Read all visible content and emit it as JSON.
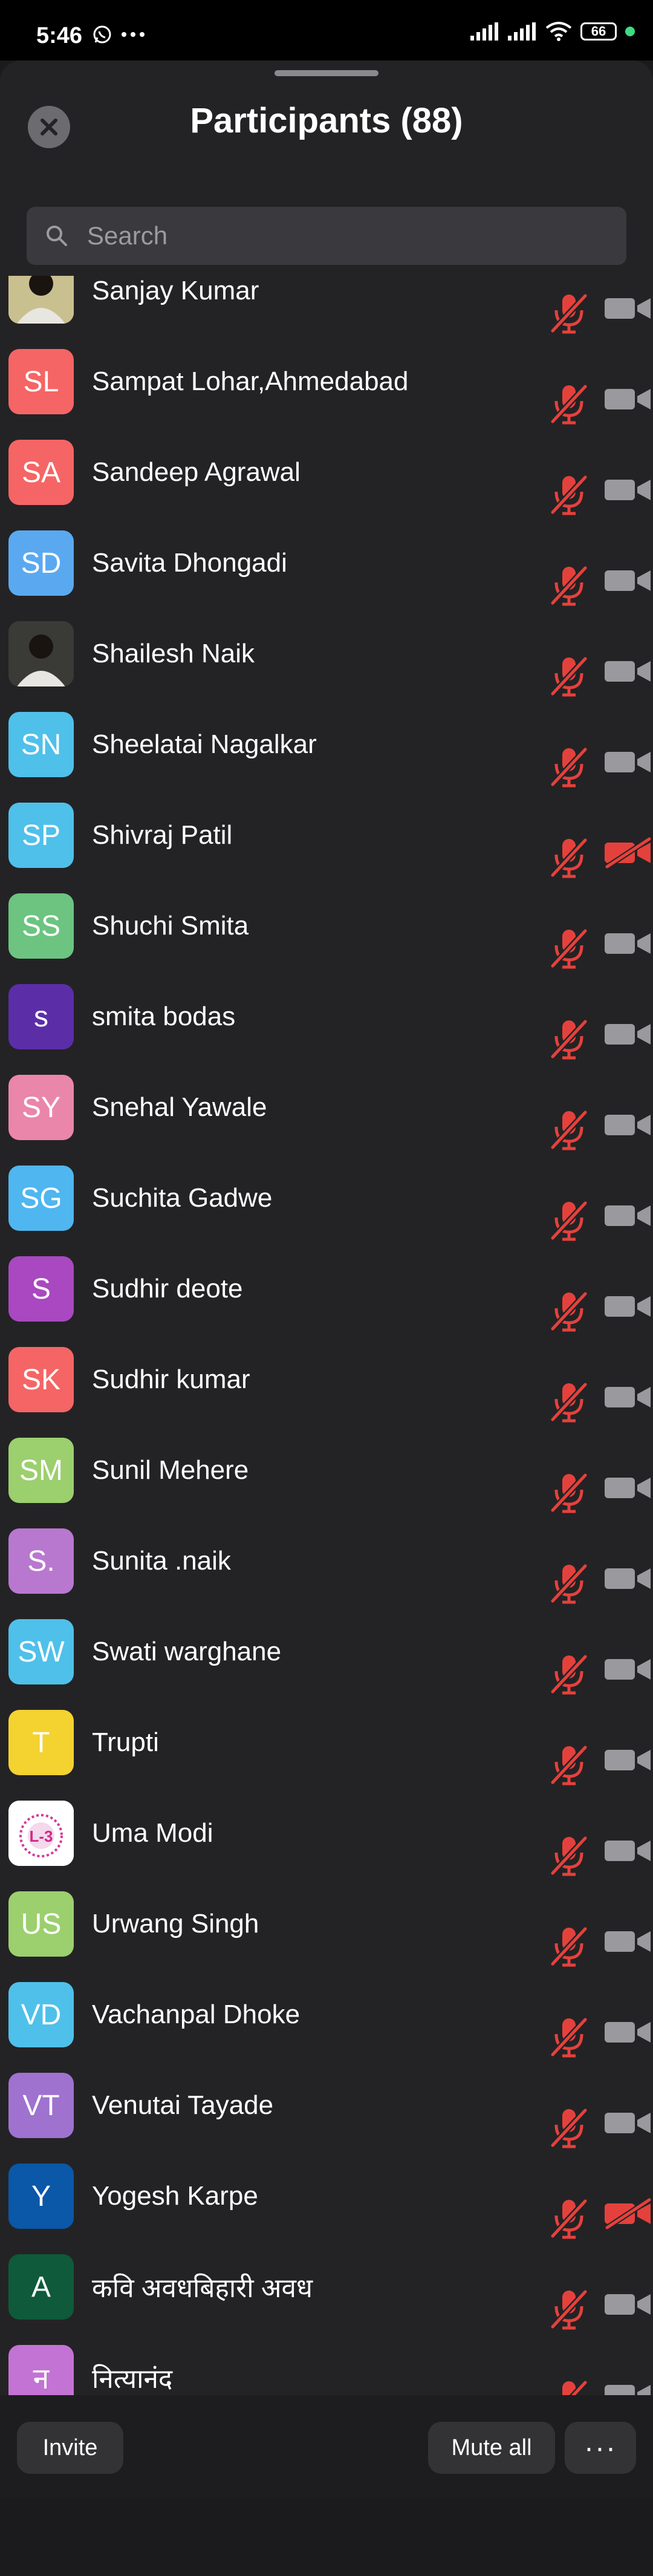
{
  "status_bar": {
    "time": "5:46",
    "battery": "66"
  },
  "header": {
    "title": "Participants (88)"
  },
  "search": {
    "placeholder": "Search"
  },
  "participants": [
    {
      "initials": "",
      "name": "Sanjay Kumar",
      "color": "#c9c08f",
      "avatar_type": "photo",
      "video_off": false
    },
    {
      "initials": "SL",
      "name": "Sampat Lohar,Ahmedabad",
      "color": "#f56565",
      "video_off": false
    },
    {
      "initials": "SA",
      "name": "Sandeep Agrawal",
      "color": "#f56565",
      "video_off": false
    },
    {
      "initials": "SD",
      "name": "Savita Dhongadi",
      "color": "#5aa9f0",
      "video_off": false
    },
    {
      "initials": "",
      "name": "Shailesh Naik",
      "color": "#3a3a36",
      "avatar_type": "photo",
      "video_off": false
    },
    {
      "initials": "SN",
      "name": "Sheelatai Nagalkar",
      "color": "#4fc0ea",
      "video_off": false
    },
    {
      "initials": "SP",
      "name": "Shivraj Patil",
      "color": "#4fc0ea",
      "video_off": true
    },
    {
      "initials": "SS",
      "name": "Shuchi Smita",
      "color": "#6cc480",
      "video_off": false
    },
    {
      "initials": "s",
      "name": "smita bodas",
      "color": "#5b2ea8",
      "video_off": false
    },
    {
      "initials": "SY",
      "name": "Snehal Yawale",
      "color": "#ea86a9",
      "video_off": false
    },
    {
      "initials": "SG",
      "name": "Suchita Gadwe",
      "color": "#4fb6ef",
      "video_off": false
    },
    {
      "initials": "S",
      "name": "Sudhir deote",
      "color": "#a948c0",
      "video_off": false
    },
    {
      "initials": "SK",
      "name": "Sudhir kumar",
      "color": "#f56565",
      "video_off": false
    },
    {
      "initials": "SM",
      "name": "Sunil Mehere",
      "color": "#9ccf6e",
      "video_off": false
    },
    {
      "initials": "S.",
      "name": "Sunita .naik",
      "color": "#b878cf",
      "video_off": false
    },
    {
      "initials": "SW",
      "name": "Swati warghane",
      "color": "#4fc0ea",
      "video_off": false
    },
    {
      "initials": "T",
      "name": "Trupti",
      "color": "#f4d22f",
      "video_off": false
    },
    {
      "initials": "",
      "name": "Uma Modi",
      "color": "#ffffff",
      "avatar_type": "logo",
      "video_off": false
    },
    {
      "initials": "US",
      "name": "Urwang Singh",
      "color": "#9ccf6e",
      "video_off": false
    },
    {
      "initials": "VD",
      "name": "Vachanpal Dhoke",
      "color": "#4fc0ea",
      "video_off": false
    },
    {
      "initials": "VT",
      "name": "Venutai Tayade",
      "color": "#9f72cf",
      "video_off": false
    },
    {
      "initials": "Y",
      "name": "Yogesh Karpe",
      "color": "#0b57a8",
      "video_off": true
    },
    {
      "initials": "A",
      "name": "कवि अवधबिहारी अवध",
      "color": "#0e5a3a",
      "video_off": false
    },
    {
      "initials": "न",
      "name": "नित्यानंद",
      "color": "#c373d3",
      "video_off": false
    }
  ],
  "logo_text": "L-3",
  "bottom_bar": {
    "invite_label": "Invite",
    "mute_all_label": "Mute all",
    "more_label": "···"
  },
  "icons": {
    "close": "close-icon",
    "search": "search-icon",
    "mic_muted": "mic-muted-icon",
    "video": "video-icon",
    "video_off": "video-off-icon"
  },
  "colors": {
    "muted_red": "#e5413c",
    "video_gray": "#9a9a9e"
  }
}
